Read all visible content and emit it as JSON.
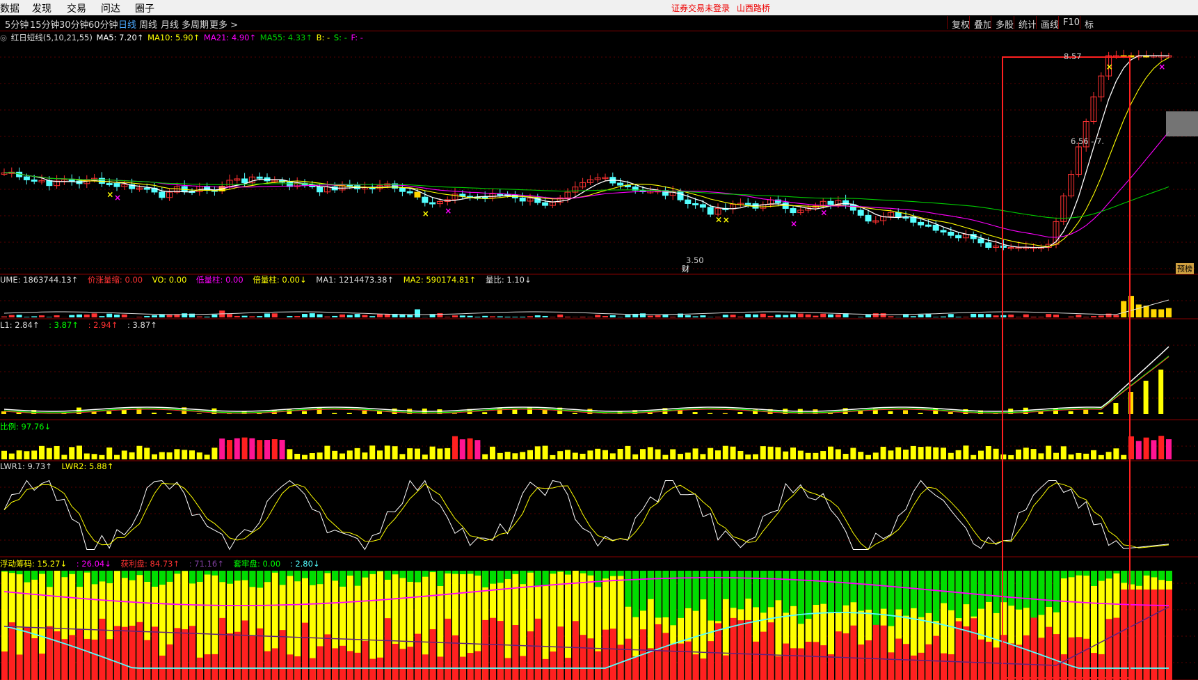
{
  "menubar": {
    "items": [
      "数据",
      "发现",
      "交易",
      "问达",
      "圈子"
    ],
    "notice": [
      "证券交易未登录",
      "山西路桥"
    ]
  },
  "periods": {
    "items": [
      "5分钟",
      "15分钟",
      "30分钟",
      "60分钟",
      "日线",
      "周线",
      "月线",
      "多周期",
      "更多 >"
    ],
    "active": "日线"
  },
  "toolbar_right": [
    "复权",
    "叠加",
    "多股",
    "统计",
    "画线",
    "F10",
    "标"
  ],
  "main_panel": {
    "indicator_name": "红日短线(5,10,21,55)",
    "ma5": "MA5: 7.20↑",
    "ma10": "MA10: 5.90↑",
    "ma21": "MA21: 4.90↑",
    "ma55": "MA55: 4.33↑",
    "b": "B: -",
    "s": "S: -",
    "f": "F: -",
    "price_high": "8.57",
    "price_range": "6.56 - 7.",
    "price_low": "3.50",
    "finance_mark": "财",
    "forecast_button": "预榜"
  },
  "volume_panel": {
    "vol": "UME: 1863744.13↑",
    "price_up_vol_down": "价涨量缩: 0.00",
    "vo": "VO: 0.00",
    "low_vol": "低量柱: 0.00",
    "double_vol": "倍量柱: 0.00↓",
    "ma1": "MA1: 1214473.38↑",
    "ma2": "MA2: 590174.81↑",
    "vol_ratio": "量比: 1.10↓"
  },
  "panel3": {
    "l1": "L1: 2.84↑",
    "l2": ": 3.87↑",
    "l3": ": 2.94↑",
    "l4": ": 3.87↑"
  },
  "panel4": {
    "label": "比例: 97.76↓"
  },
  "panel5": {
    "lwr1": "LWR1: 9.73↑",
    "lwr2": "LWR2: 5.88↑"
  },
  "panel6": {
    "float_chips": "浮动筹码: 15.27↓",
    "v2": ": 26.04↓",
    "profit": "获利盘: 84.73↑",
    "v4": ": 71.16↑",
    "trapped": "套牢盘: 0.00",
    "v6": ": 2.80↓"
  },
  "colors": {
    "up": "#ff3232",
    "down": "#54ffff",
    "ma5": "#ffffff",
    "ma10": "#ffff00",
    "ma21": "#ff00ff",
    "ma55": "#00cc00",
    "highlight_box": "#ff2020",
    "panel_border": "#8a0000"
  }
}
